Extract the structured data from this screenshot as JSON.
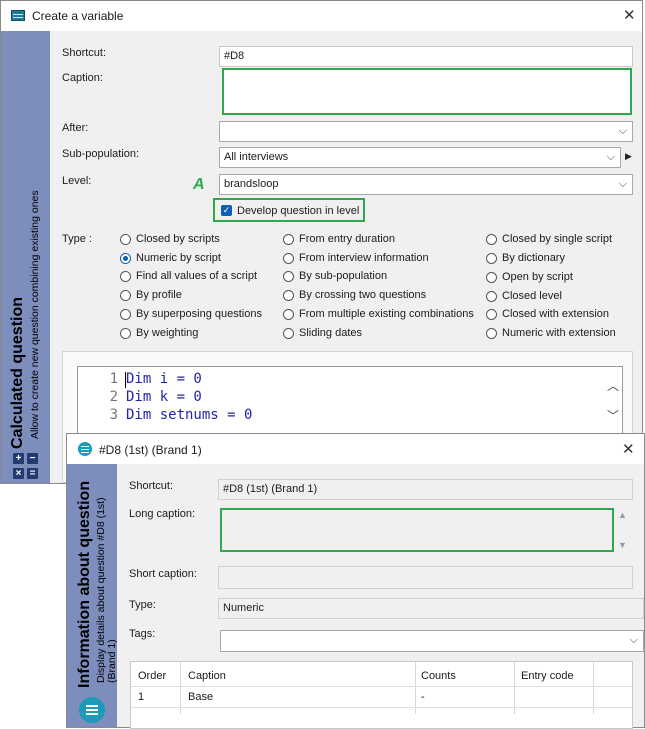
{
  "win1": {
    "title": "Create a variable",
    "sidebar_title": "Calculated question",
    "sidebar_subtitle": "Allow to create new question combining existing ones",
    "shortcut_label": "Shortcut:",
    "shortcut_value": "#D8",
    "caption_label": "Caption:",
    "caption_value": "",
    "after_label": "After:",
    "after_value": "",
    "subpop_label": "Sub-population:",
    "subpop_value": "All interviews",
    "level_label": "Level:",
    "level_marker": "A",
    "level_value": "brandsloop",
    "develop_label": "Develop question in level",
    "type_label": "Type :",
    "type_col1": [
      "Closed by scripts",
      "Numeric by script",
      "Find all values of a script",
      "By profile",
      "By superposing questions",
      "By weighting"
    ],
    "type_col2": [
      "From entry duration",
      "From interview information",
      "By sub-population",
      "By crossing two questions",
      "From multiple existing combinations",
      "Sliding dates"
    ],
    "type_col3": [
      "Closed by single script",
      "By dictionary",
      "Open by script",
      "Closed level",
      "Closed with extension",
      "Numeric with extension"
    ],
    "selected_type": "Numeric by script",
    "code_lines": [
      {
        "n": "1",
        "text": "Dim i = 0"
      },
      {
        "n": "2",
        "text": "Dim k = 0"
      },
      {
        "n": "3",
        "text": "Dim setnums = 0"
      }
    ]
  },
  "win2": {
    "title": "#D8 (1st) (Brand 1)",
    "sidebar_title": "Information about question",
    "sidebar_subtitle": "Display details about question #D8 (1st) (Brand 1)",
    "shortcut_label": "Shortcut:",
    "shortcut_value": "#D8 (1st) (Brand 1)",
    "long_caption_label": "Long caption:",
    "long_caption_value": "",
    "short_caption_label": "Short caption:",
    "short_caption_value": "",
    "type_label": "Type:",
    "type_value": "Numeric",
    "tags_label": "Tags:",
    "tags_value": "",
    "table_headers": [
      "Order",
      "Caption",
      "Counts",
      "Entry code"
    ],
    "table_rows": [
      [
        "1",
        "Base",
        "-",
        ""
      ]
    ]
  },
  "colors": {
    "accent_green": "#2fa84f",
    "sidebar": "#7d8ebd",
    "code_blue": "#2424a8",
    "selected_blue": "#0a5fb4"
  },
  "icons": [
    "table-icon",
    "close-icon",
    "chevron-down-icon",
    "triangle-right-icon",
    "plus-icon",
    "minus-icon",
    "x-icon",
    "equals-icon",
    "scroll-up-icon",
    "scroll-down-icon",
    "checkbox-checked-icon",
    "grid-icon"
  ]
}
